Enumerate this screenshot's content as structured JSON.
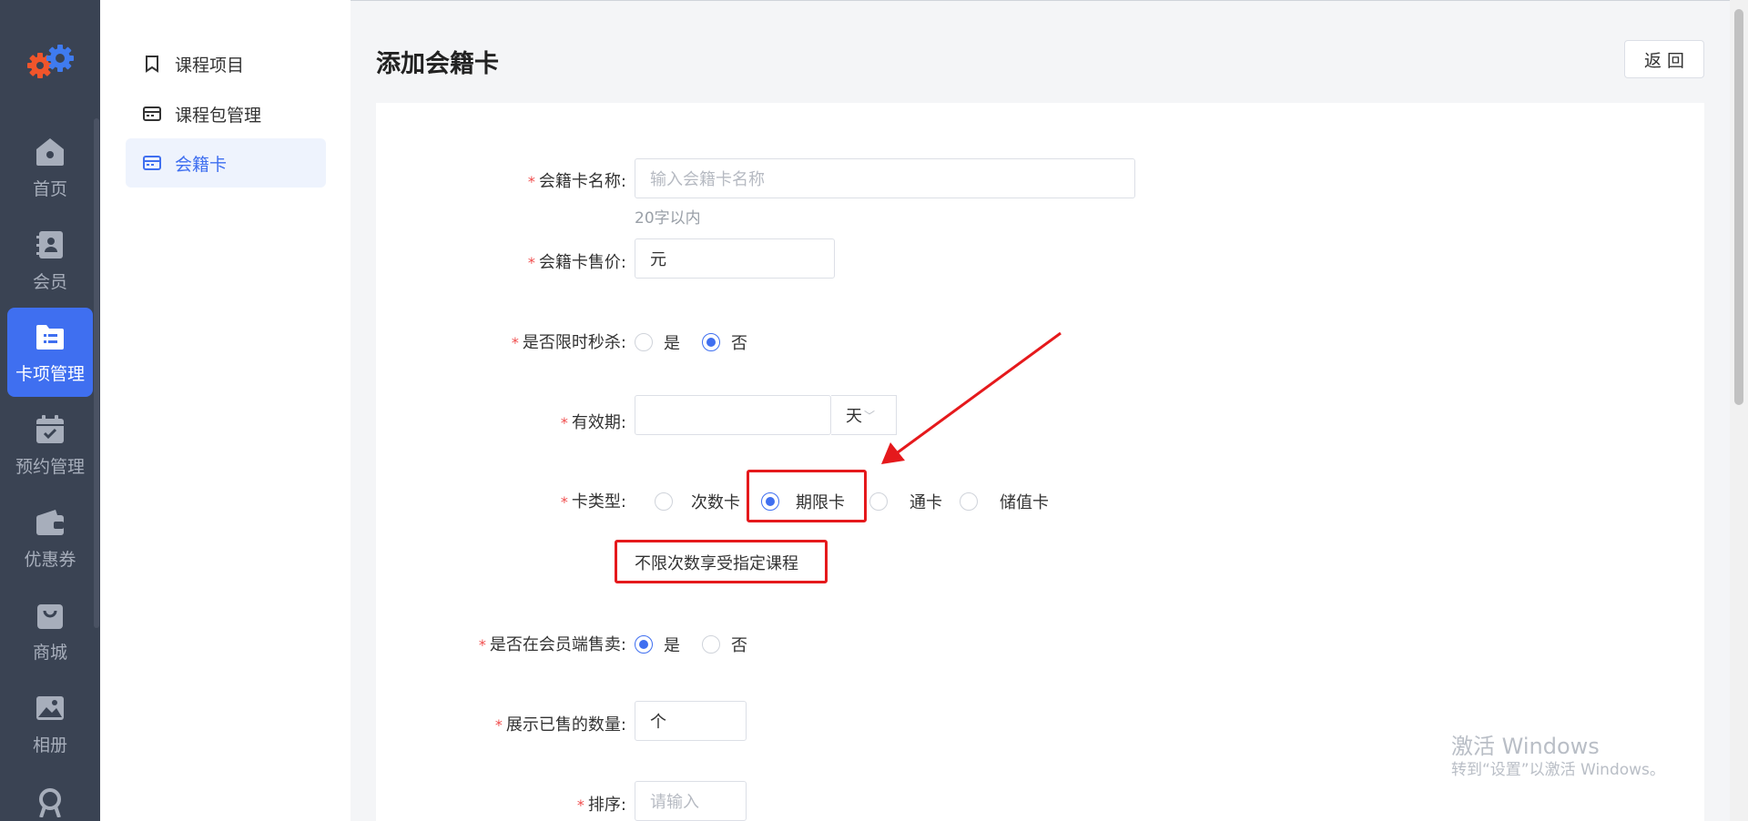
{
  "nav": {
    "items": [
      {
        "label": "首页",
        "icon": "home-icon"
      },
      {
        "label": "会员",
        "icon": "member-icon"
      },
      {
        "label": "卡项管理",
        "icon": "card-folder-icon",
        "active": true
      },
      {
        "label": "预约管理",
        "icon": "calendar-icon"
      },
      {
        "label": "优惠券",
        "icon": "wallet-icon"
      },
      {
        "label": "商城",
        "icon": "shopping-bag-icon"
      },
      {
        "label": "相册",
        "icon": "image-icon"
      }
    ]
  },
  "subnav": {
    "items": [
      {
        "label": "课程项目",
        "icon": "bookmark-icon"
      },
      {
        "label": "课程包管理",
        "icon": "package-icon"
      },
      {
        "label": "会籍卡",
        "icon": "card-icon",
        "active": true
      }
    ]
  },
  "page": {
    "title": "添加会籍卡",
    "back_label": "返 回"
  },
  "form": {
    "name": {
      "label": "会籍卡名称:",
      "placeholder": "输入会籍卡名称",
      "hint": "20字以内"
    },
    "price": {
      "label": "会籍卡售价:",
      "suffix": "元"
    },
    "flash_sale": {
      "label": "是否限时秒杀:",
      "options": [
        "是",
        "否"
      ],
      "selected": "否"
    },
    "validity": {
      "label": "有效期:",
      "unit": "天"
    },
    "card_type": {
      "label": "卡类型:",
      "options": [
        "次数卡",
        "期限卡",
        "通卡",
        "储值卡"
      ],
      "selected": "期限卡",
      "description": "不限次数享受指定课程"
    },
    "member_sale": {
      "label": "是否在会员端售卖:",
      "options": [
        "是",
        "否"
      ],
      "selected": "是"
    },
    "sold_count": {
      "label": "展示已售的数量:",
      "suffix": "个"
    },
    "sort": {
      "label": "排序:",
      "placeholder": "请输入"
    }
  },
  "watermark": {
    "line1": "激活 Windows",
    "line2": "转到“设置”以激活 Windows。"
  },
  "colors": {
    "accent": "#3f6ff0",
    "annotation": "#e5191c",
    "sidebar": "#3a4353"
  }
}
